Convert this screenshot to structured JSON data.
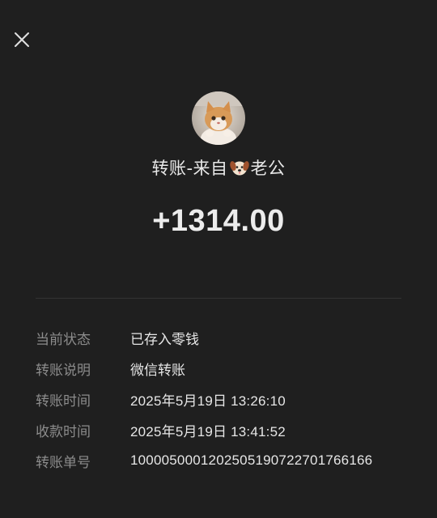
{
  "header": {
    "close_icon": "close-icon"
  },
  "sender": {
    "avatar_icon": "cat-avatar",
    "title_prefix": "转账-来自",
    "title_emoji_icon": "dog-face-icon",
    "title_suffix": "老公"
  },
  "transfer": {
    "amount": "+1314.00"
  },
  "details": [
    {
      "label": "当前状态",
      "value": "已存入零钱"
    },
    {
      "label": "转账说明",
      "value": "微信转账"
    },
    {
      "label": "转账时间",
      "value": "2025年5月19日 13:26:10"
    },
    {
      "label": "收款时间",
      "value": "2025年5月19日 13:41:52"
    },
    {
      "label": "转账单号",
      "value": "1000050001202505190722701766166"
    }
  ],
  "colors": {
    "background": "#1f1f1f",
    "primary_text": "#e6e6e6",
    "secondary_text": "#8c8c8c",
    "divider": "#333333"
  }
}
